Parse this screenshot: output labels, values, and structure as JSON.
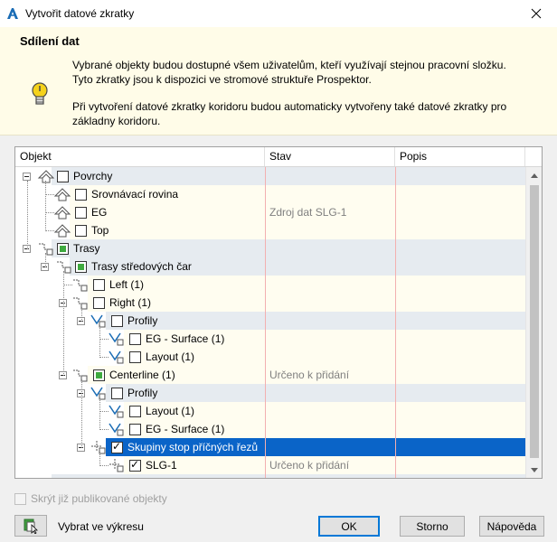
{
  "window": {
    "title": "Vytvořit datové zkratky"
  },
  "info": {
    "heading": "Sdílení dat",
    "paragraph1": "Vybrané objekty budou dostupné všem uživatelům, kteří využívají stejnou pracovní složku. Tyto zkratky jsou k dispozici ve stromové struktuře Prospektor.",
    "paragraph2": "Při vytvoření datové zkratky koridoru budou automaticky vytvořeny také datové zkratky pro základny koridoru."
  },
  "tree": {
    "columns": [
      "Objekt",
      "Stav",
      "Popis"
    ],
    "rows": [
      {
        "label": "Povrchy",
        "stav": ""
      },
      {
        "label": "Srovnávací rovina",
        "stav": ""
      },
      {
        "label": "EG",
        "stav": "Zdroj dat SLG-1"
      },
      {
        "label": "Top",
        "stav": ""
      },
      {
        "label": "Trasy",
        "stav": ""
      },
      {
        "label": "Trasy středových čar",
        "stav": ""
      },
      {
        "label": "Left (1)",
        "stav": ""
      },
      {
        "label": "Right (1)",
        "stav": ""
      },
      {
        "label": "Profily",
        "stav": ""
      },
      {
        "label": "EG - Surface (1)",
        "stav": ""
      },
      {
        "label": "Layout (1)",
        "stav": ""
      },
      {
        "label": "Centerline (1)",
        "stav": "Určeno k přidání"
      },
      {
        "label": "Profily",
        "stav": ""
      },
      {
        "label": "Layout (1)",
        "stav": ""
      },
      {
        "label": "EG - Surface (1)",
        "stav": ""
      },
      {
        "label": "Skupiny stop příčných řezů",
        "stav": ""
      },
      {
        "label": "SLG-1",
        "stav": "Určeno k přidání"
      },
      {
        "label": "",
        "stav": ""
      }
    ]
  },
  "footer": {
    "hide_published": "Skrýt již publikované objekty",
    "pick_in_drawing": "Vybrat ve výkresu",
    "ok": "OK",
    "cancel": "Storno",
    "help": "Nápověda"
  },
  "colors": {
    "selection": "#0a64c8",
    "category_row": "#e6ebf0",
    "item_row": "#fffdf0",
    "info_bg": "#fffce8"
  },
  "icons": [
    "autocad-icon",
    "close-icon",
    "lightbulb-icon",
    "surface-icon",
    "alignment-icon",
    "profile-icon",
    "sample-line-icon",
    "pick-icon"
  ]
}
